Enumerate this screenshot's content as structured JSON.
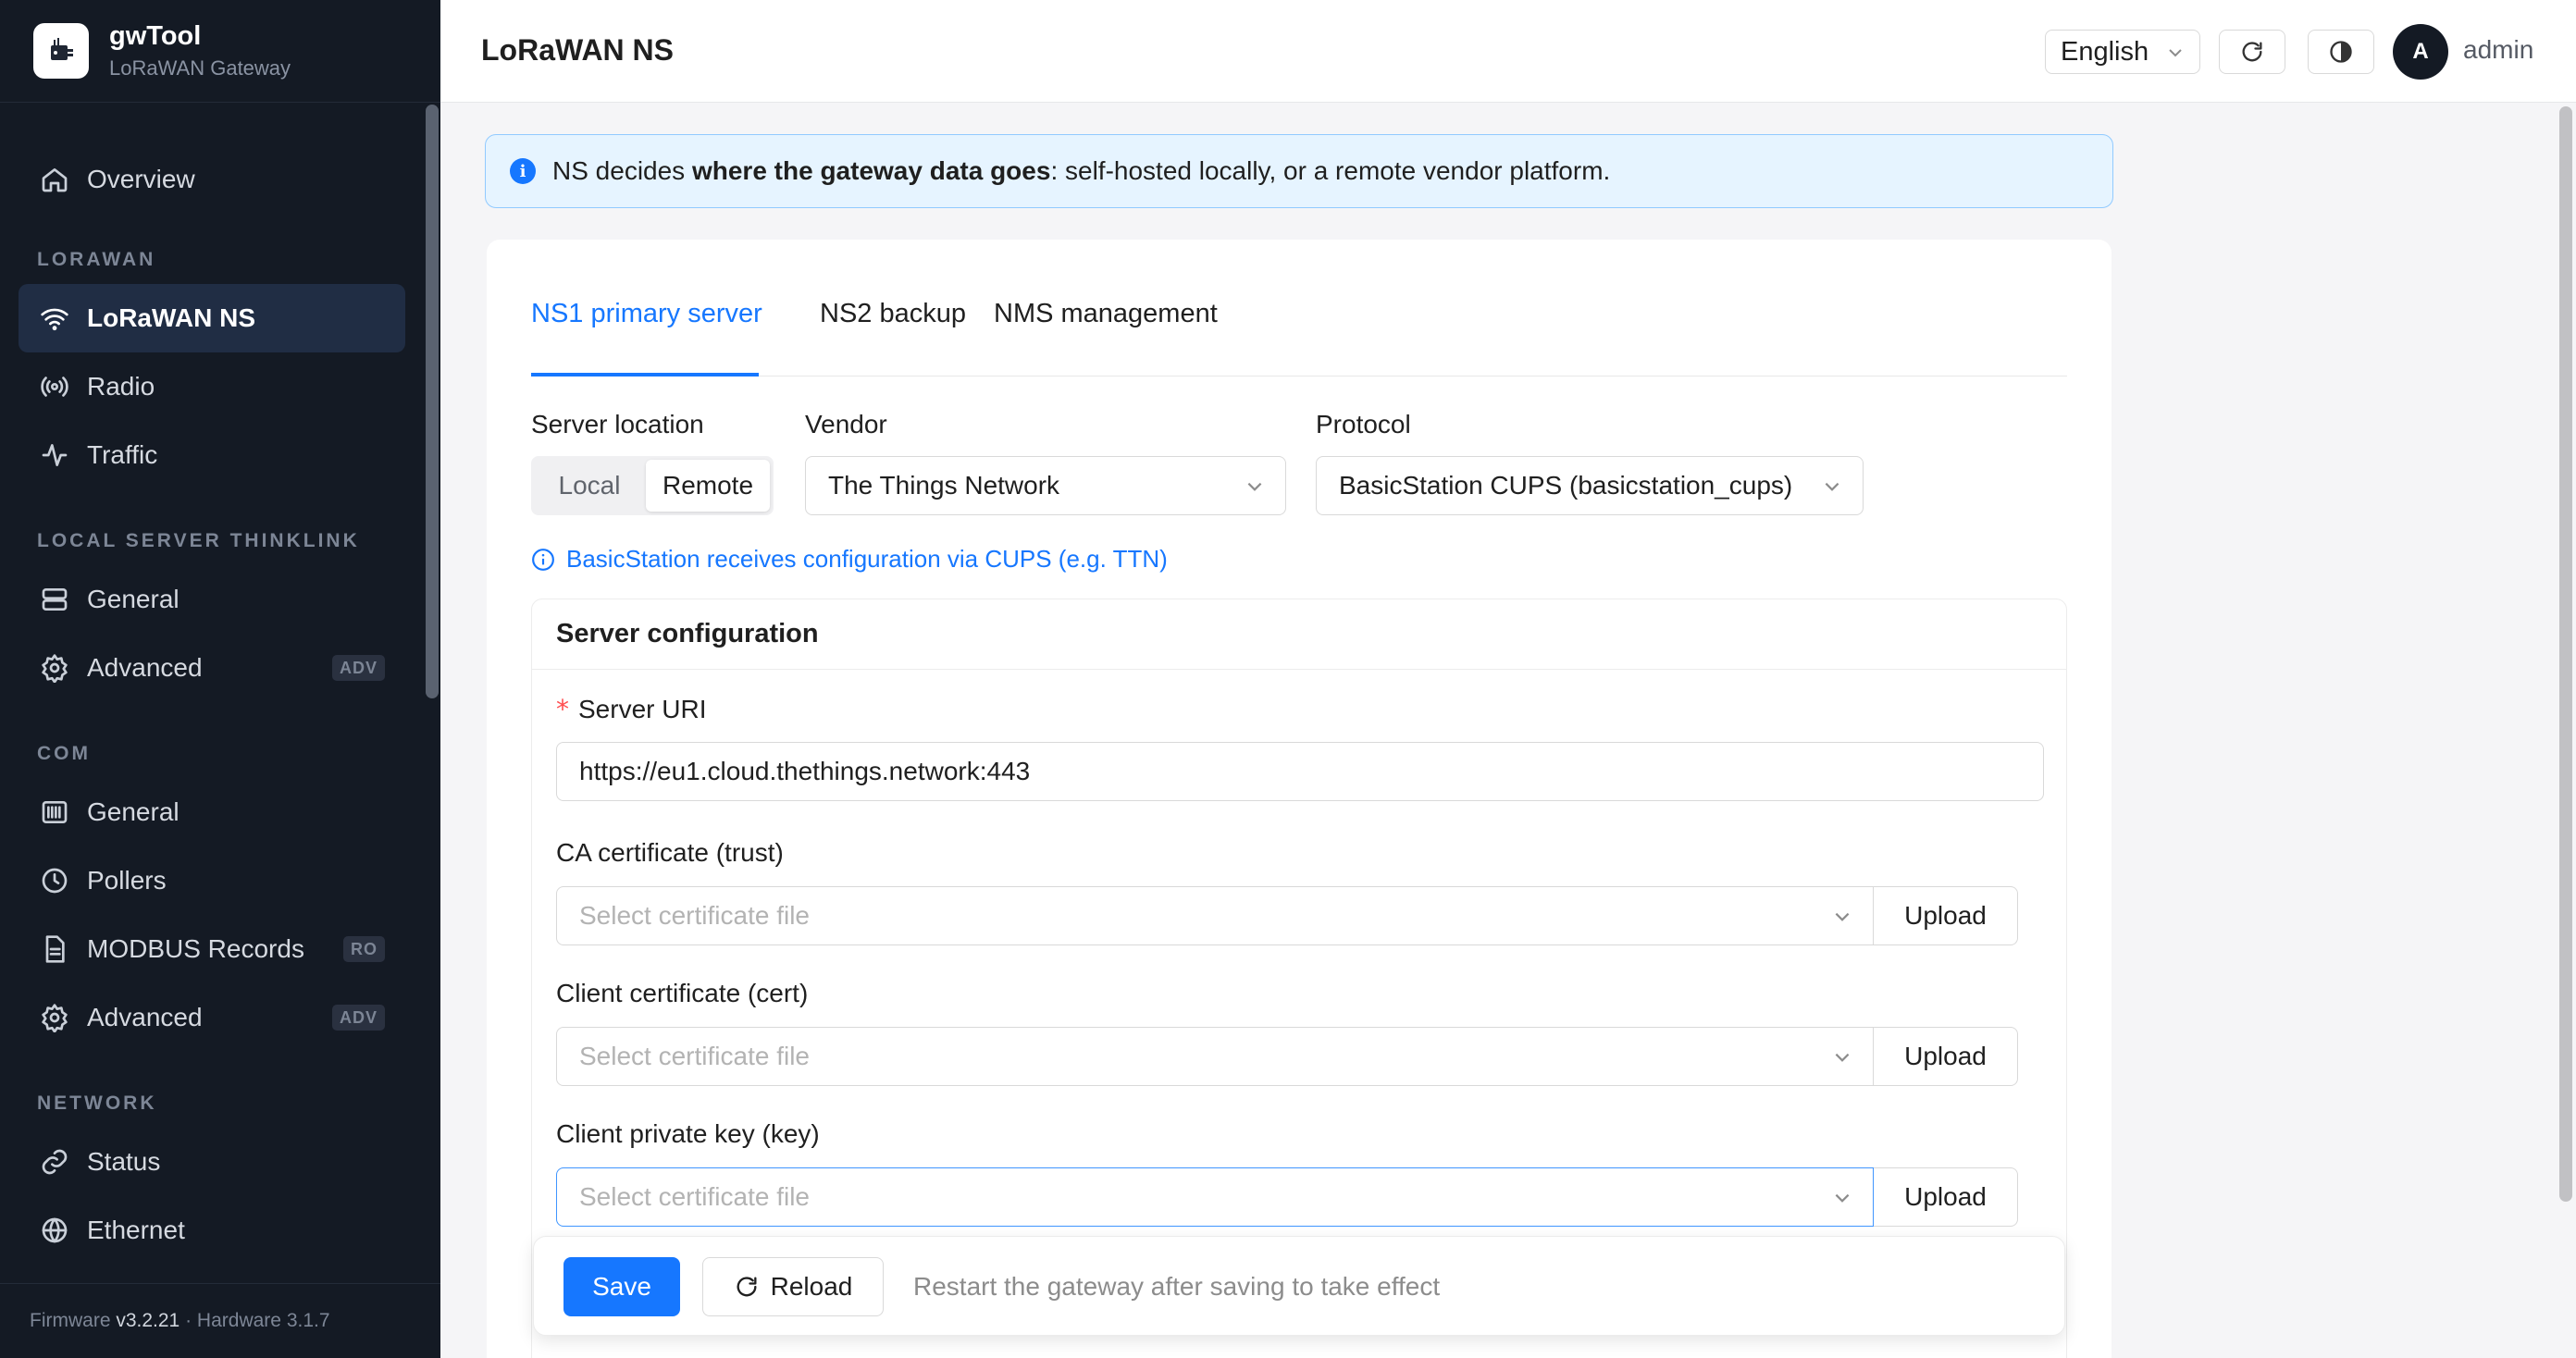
{
  "app": {
    "name": "gwTool",
    "subtitle": "LoRaWAN Gateway"
  },
  "sidebar": {
    "items": [
      {
        "label": "Overview",
        "icon": "home-icon"
      },
      {
        "label": "LoRaWAN NS",
        "icon": "wifi-icon",
        "active": true
      },
      {
        "label": "Radio",
        "icon": "radio-waves-icon"
      },
      {
        "label": "Traffic",
        "icon": "activity-icon"
      },
      {
        "label": "General",
        "icon": "server-icon"
      },
      {
        "label": "Advanced",
        "icon": "gear-icon",
        "badge": "ADV"
      },
      {
        "label": "General",
        "icon": "barcode-icon"
      },
      {
        "label": "Pollers",
        "icon": "clock-icon"
      },
      {
        "label": "MODBUS Records",
        "icon": "document-icon",
        "badge": "RO"
      },
      {
        "label": "Advanced",
        "icon": "gear-icon",
        "badge": "ADV"
      },
      {
        "label": "Status",
        "icon": "link-icon"
      },
      {
        "label": "Ethernet",
        "icon": "globe-icon"
      }
    ],
    "sections": [
      "LORAWAN",
      "LOCAL SERVER THINKLINK",
      "COM",
      "NETWORK"
    ],
    "footer": {
      "firmware_label": "Firmware",
      "firmware_version": "v3.2.21",
      "separator": "·",
      "hardware_label": "Hardware",
      "hardware_version": "3.1.7"
    }
  },
  "header": {
    "title": "LoRaWAN NS",
    "language": "English",
    "avatar_initial": "A",
    "user": "admin"
  },
  "banner": {
    "prefix": "NS decides ",
    "bold": "where the gateway data goes",
    "suffix": ": self-hosted locally, or a remote vendor platform."
  },
  "tabs": [
    {
      "label": "NS1 primary server",
      "active": true
    },
    {
      "label": "NS2 backup"
    },
    {
      "label": "NMS management"
    }
  ],
  "form": {
    "server_location": {
      "label": "Server location",
      "options": [
        "Local",
        "Remote"
      ],
      "selected": "Remote"
    },
    "vendor": {
      "label": "Vendor",
      "value": "The Things Network"
    },
    "protocol": {
      "label": "Protocol",
      "value": "BasicStation CUPS (basicstation_cups)"
    },
    "hint": "BasicStation receives configuration via CUPS (e.g. TTN)"
  },
  "server_config": {
    "title": "Server configuration",
    "required_mark": "*",
    "uri_label": "Server URI",
    "uri_value": "https://eu1.cloud.thethings.network:443",
    "ca_label": "CA certificate (trust)",
    "cert_label": "Client certificate (cert)",
    "key_label": "Client private key (key)",
    "file_placeholder": "Select certificate file",
    "upload_label": "Upload"
  },
  "actions": {
    "save": "Save",
    "reload": "Reload",
    "note": "Restart the gateway after saving to take effect"
  },
  "colors": {
    "sidebar_bg": "#141a24",
    "active_nav_bg": "#202d44",
    "primary": "#1677ff",
    "banner_bg": "#e6f4ff",
    "required": "#ff4d4f"
  }
}
